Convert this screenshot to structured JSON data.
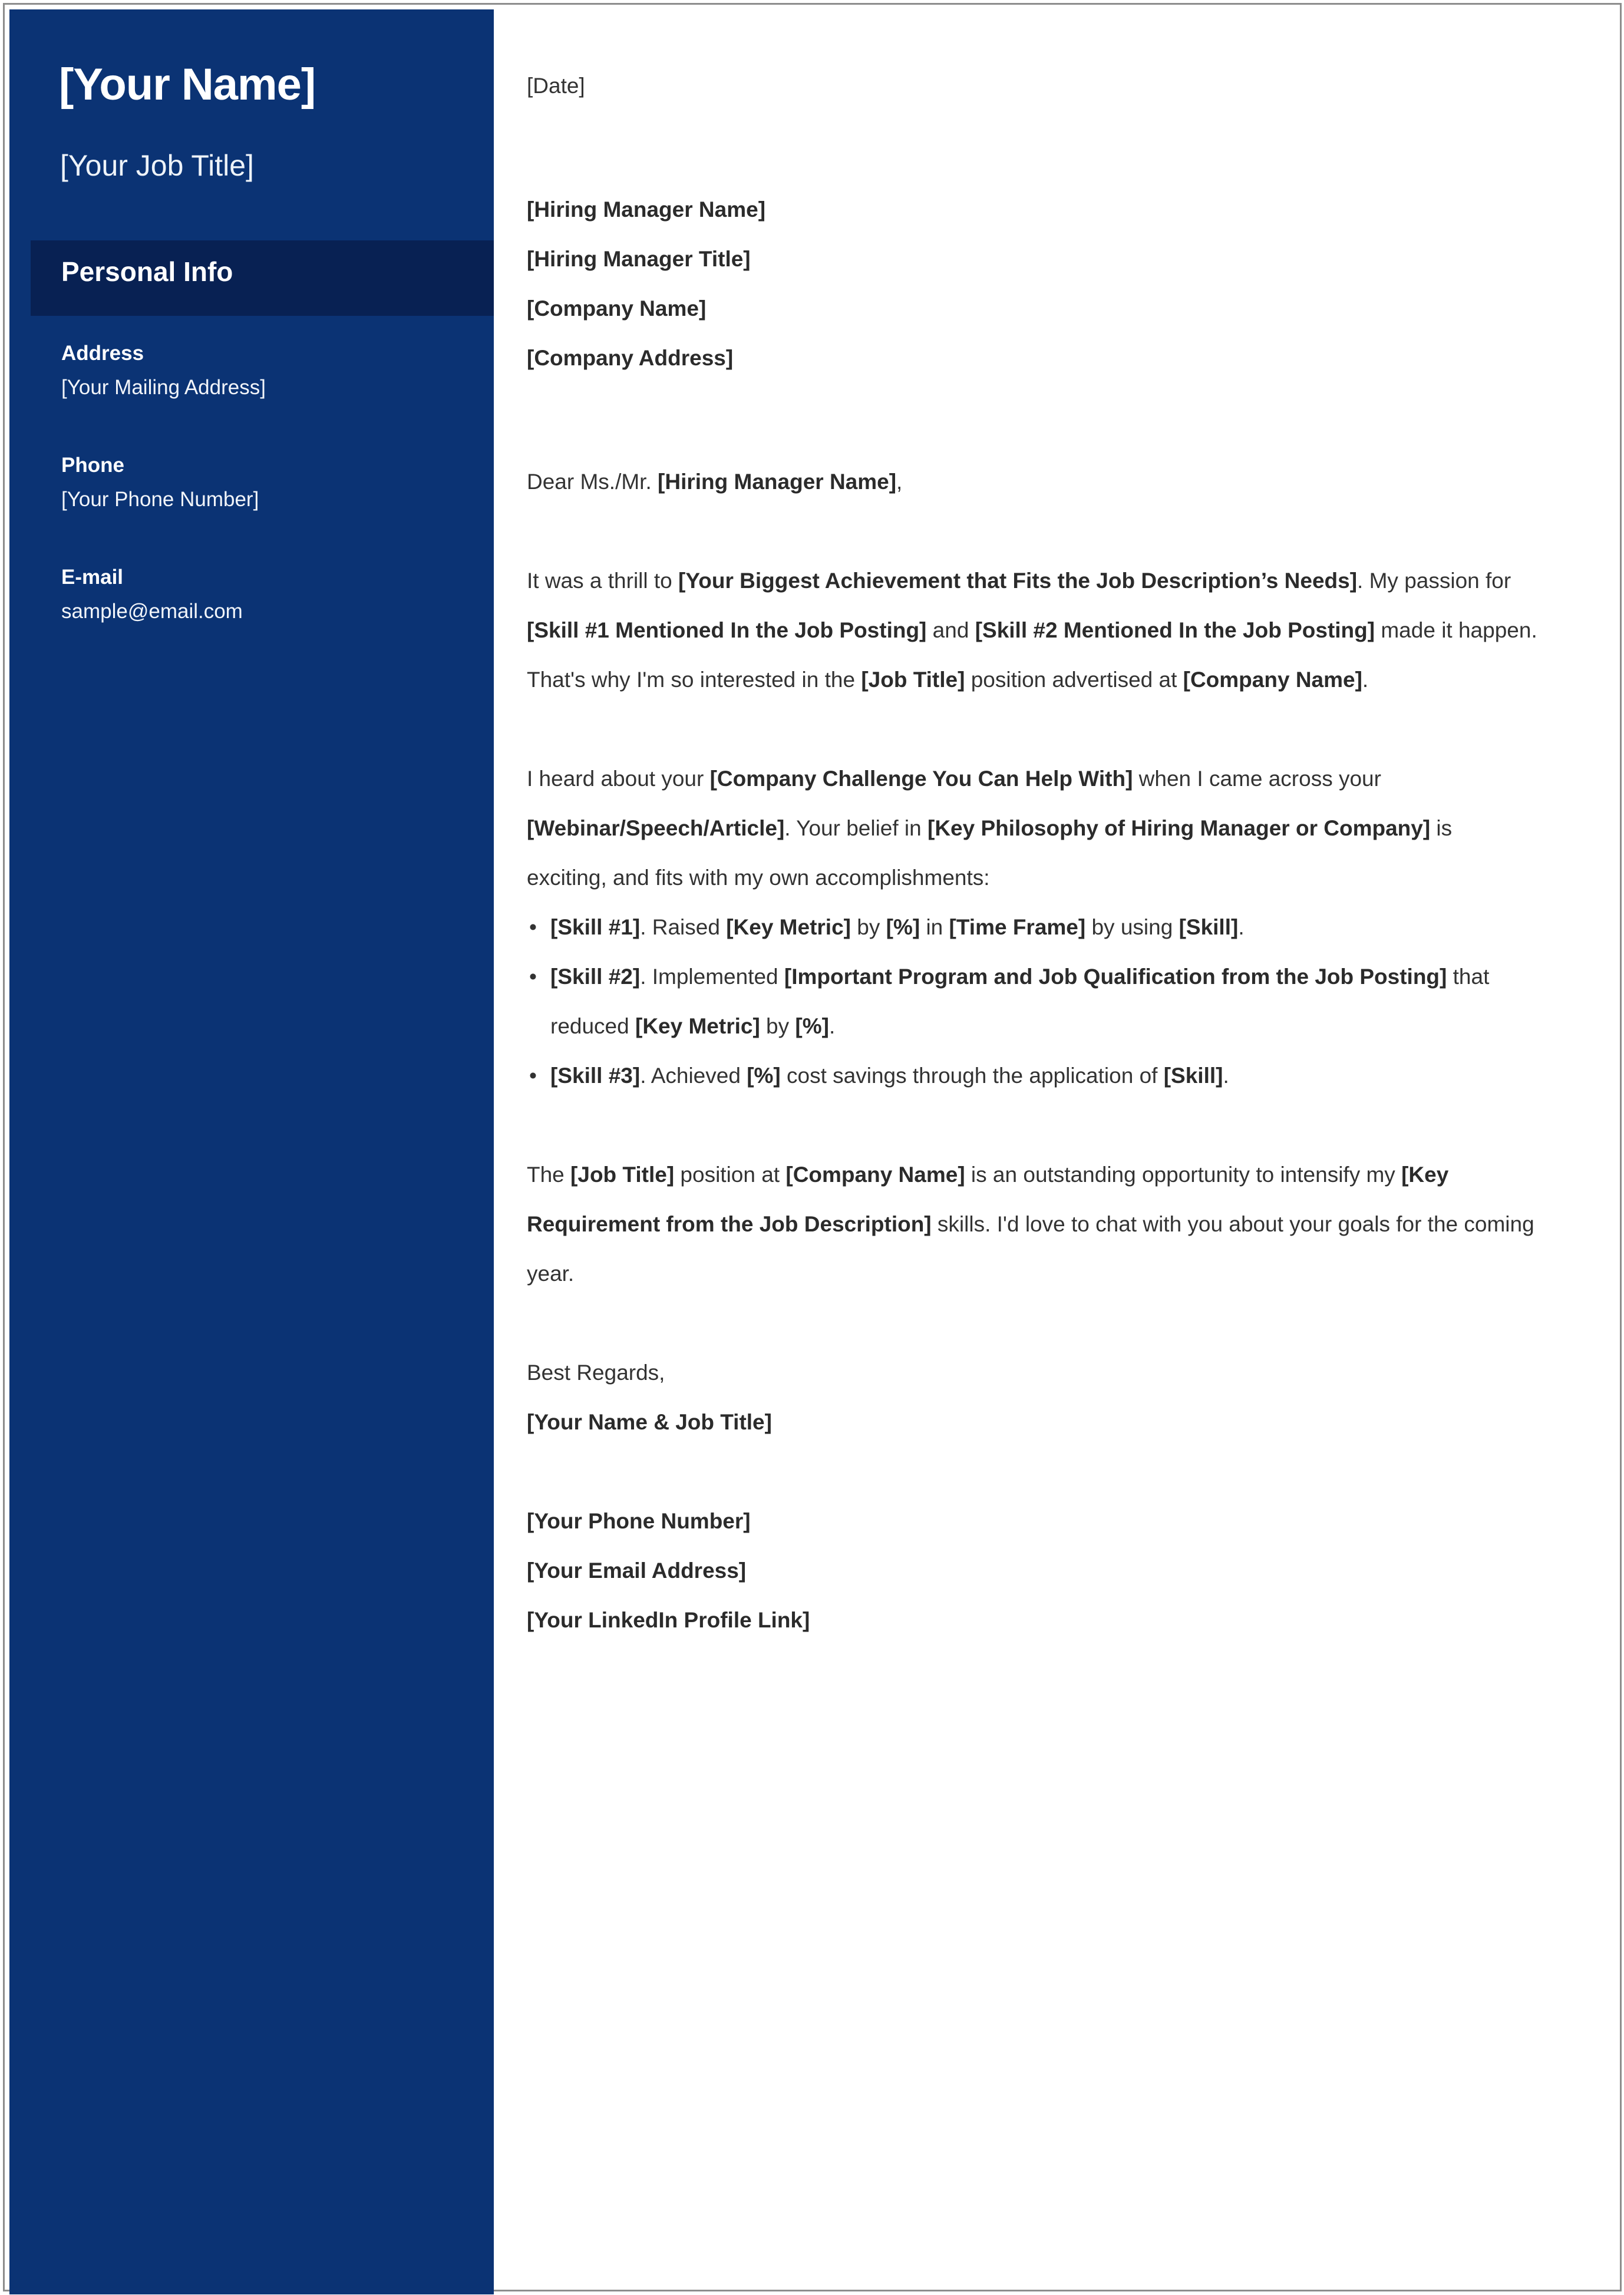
{
  "document": {
    "type": "cover-letter-template",
    "accent_color": "#0B3374",
    "band_color": "#082153",
    "body_text_color": "#333333",
    "page_background": "#FFFFFF",
    "border_color": "#8D8D8D"
  },
  "sidebar": {
    "name": "[Your Name]",
    "job_title": "[Your Job Title]",
    "section_title": "Personal Info",
    "fields": [
      {
        "label": "Address",
        "value": "[Your Mailing Address]"
      },
      {
        "label": "Phone",
        "value": "[Your Phone Number]"
      },
      {
        "label": "E-mail",
        "value": "sample@email.com"
      }
    ]
  },
  "letter": {
    "date": "[Date]",
    "recipient": [
      "[Hiring Manager Name]",
      "[Hiring Manager Title]",
      "[Company Name]",
      "[Company Address]"
    ],
    "salutation": {
      "prefix": "Dear Ms./Mr. ",
      "name": "[Hiring Manager Name]",
      "suffix": ","
    },
    "paragraph_1": [
      {
        "text": "It was a thrill to ",
        "bold": false
      },
      {
        "text": "[Your Biggest Achievement that Fits the Job Description’s Needs]",
        "bold": true
      },
      {
        "text": ". My passion for ",
        "bold": false
      },
      {
        "text": "[Skill #1 Mentioned In the Job Posting]",
        "bold": true
      },
      {
        "text": " and ",
        "bold": false
      },
      {
        "text": "[Skill #2 Mentioned In the Job Posting]",
        "bold": true
      },
      {
        "text": " made it happen. That's why I'm so interested in the ",
        "bold": false
      },
      {
        "text": "[Job Title]",
        "bold": true
      },
      {
        "text": " position advertised at ",
        "bold": false
      },
      {
        "text": "[Company Name]",
        "bold": true
      },
      {
        "text": ".",
        "bold": false
      }
    ],
    "paragraph_2": [
      {
        "text": "I heard about your ",
        "bold": false
      },
      {
        "text": "[Company Challenge You Can Help With]",
        "bold": true
      },
      {
        "text": " when I came across your ",
        "bold": false
      },
      {
        "text": "[Webinar/Speech/Article]",
        "bold": true
      },
      {
        "text": ". Your belief in ",
        "bold": false
      },
      {
        "text": "[Key Philosophy of Hiring Manager or Company]",
        "bold": true
      },
      {
        "text": " is exciting, and fits with my own accomplishments:",
        "bold": false
      }
    ],
    "bullet_marker": "•",
    "bullets": [
      [
        {
          "text": "[Skill #1]",
          "bold": true
        },
        {
          "text": ". Raised ",
          "bold": false
        },
        {
          "text": "[Key Metric]",
          "bold": true
        },
        {
          "text": " by ",
          "bold": false
        },
        {
          "text": "[%]",
          "bold": true
        },
        {
          "text": " in ",
          "bold": false
        },
        {
          "text": "[Time Frame]",
          "bold": true
        },
        {
          "text": " by using ",
          "bold": false
        },
        {
          "text": "[Skill]",
          "bold": true
        },
        {
          "text": ".",
          "bold": false
        }
      ],
      [
        {
          "text": "[Skill #2]",
          "bold": true
        },
        {
          "text": ". Implemented ",
          "bold": false
        },
        {
          "text": "[Important Program and Job Qualification from the Job Posting]",
          "bold": true
        },
        {
          "text": " that reduced ",
          "bold": false
        },
        {
          "text": "[Key Metric]",
          "bold": true
        },
        {
          "text": " by ",
          "bold": false
        },
        {
          "text": "[%]",
          "bold": true
        },
        {
          "text": ".",
          "bold": false
        }
      ],
      [
        {
          "text": "[Skill #3]",
          "bold": true
        },
        {
          "text": ". Achieved ",
          "bold": false
        },
        {
          "text": "[%]",
          "bold": true
        },
        {
          "text": " cost savings through the application of ",
          "bold": false
        },
        {
          "text": "[Skill]",
          "bold": true
        },
        {
          "text": ".",
          "bold": false
        }
      ]
    ],
    "paragraph_3": [
      {
        "text": "The ",
        "bold": false
      },
      {
        "text": "[Job Title]",
        "bold": true
      },
      {
        "text": " position at ",
        "bold": false
      },
      {
        "text": "[Company Name]",
        "bold": true
      },
      {
        "text": " is an outstanding opportunity to intensify my ",
        "bold": false
      },
      {
        "text": "[Key Requirement from the Job Description]",
        "bold": true
      },
      {
        "text": " skills. I'd love to chat with you about your goals for the coming year.",
        "bold": false
      }
    ],
    "closing": "Best Regards,",
    "signature_name": "[Your Name & Job Title]",
    "contact_lines": [
      "[Your Phone Number]",
      "[Your Email Address]",
      "[Your LinkedIn Profile Link]"
    ]
  }
}
